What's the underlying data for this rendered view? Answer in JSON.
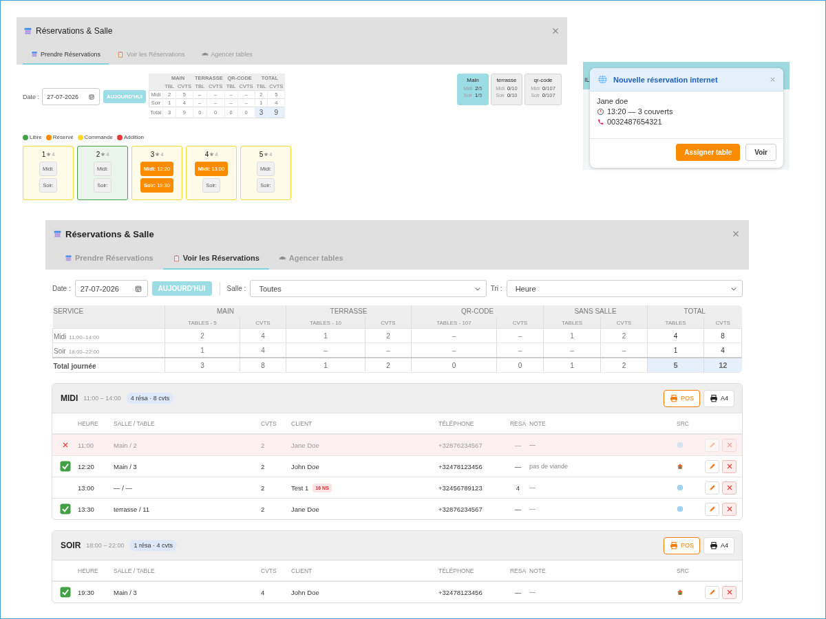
{
  "booking_panel": {
    "title": "Réservations & Salle",
    "tabs": [
      {
        "label": "Prendre Réservations",
        "selected": true
      },
      {
        "label": "Voir les Réservations",
        "selected": false
      },
      {
        "label": "Agencer tables",
        "selected": false
      }
    ],
    "date": {
      "label": "Date :",
      "value": "27-07-2026"
    },
    "today_button": "AUJOURD'HUI",
    "summary": {
      "groups": [
        {
          "label": "MAIN",
          "subs": [
            "TBL",
            "CVTS"
          ]
        },
        {
          "label": "TERRASSE",
          "subs": [
            "TBL",
            "CVTS"
          ]
        },
        {
          "label": "QR-CODE",
          "subs": [
            "TBL",
            "CVTS"
          ]
        },
        {
          "label": "TOTAL",
          "subs": [
            "TBL",
            "CVTS"
          ]
        }
      ],
      "rows": [
        {
          "label": "Midi",
          "kind": "service",
          "cells": [
            "2",
            "5",
            "–",
            "–",
            "–",
            "–",
            "2",
            "5"
          ]
        },
        {
          "label": "Soir",
          "kind": "service",
          "cells": [
            "1",
            "4",
            "–",
            "–",
            "–",
            "–",
            "1",
            "4"
          ]
        },
        {
          "label": "Total",
          "kind": "total",
          "cells": [
            "3",
            "9",
            "0",
            "0",
            "0",
            "0",
            "3",
            "9"
          ]
        }
      ]
    },
    "rooms": [
      {
        "name": "Main",
        "selected": true,
        "lines": [
          {
            "label": "Midi",
            "value": "**2**/5"
          },
          {
            "label": "Soir",
            "value": "**1**/5"
          }
        ]
      },
      {
        "name": "terrasse",
        "selected": false,
        "lines": [
          {
            "label": "Midi",
            "value": "**0**/10"
          },
          {
            "label": "Soir",
            "value": "**0**/10"
          }
        ]
      },
      {
        "name": "qr-code",
        "selected": false,
        "lines": [
          {
            "label": "Midi",
            "value": "**0**/107"
          },
          {
            "label": "Soir",
            "value": "**0**/107"
          }
        ]
      }
    ],
    "legend": [
      {
        "label": "Libre",
        "color": "#43a047"
      },
      {
        "label": "Réservé",
        "color": "#fb8c00"
      },
      {
        "label": "Commande",
        "color": "#fdd835"
      },
      {
        "label": "Addition",
        "color": "#e53935"
      }
    ],
    "tables": [
      {
        "number": "1",
        "seats": "4",
        "color": "#fdd835",
        "slots": [
          {
            "label": "Midi:",
            "booked": false
          },
          {
            "label": "Soir:",
            "booked": false
          }
        ]
      },
      {
        "number": "2",
        "seats": "4",
        "color": "#43a047",
        "slots": [
          {
            "label": "Midi:",
            "booked": false
          },
          {
            "label": "Soir:",
            "booked": false
          }
        ]
      },
      {
        "number": "3",
        "seats": "4",
        "color": "#fdd835",
        "slots": [
          {
            "label": "Midi:",
            "time": "12:20",
            "booked": true
          },
          {
            "label": "Soir:",
            "time": "19:30",
            "booked": true
          }
        ]
      },
      {
        "number": "4",
        "seats": "4",
        "color": "#fdd835",
        "slots": [
          {
            "label": "Midi:",
            "time": "13:00",
            "booked": true
          },
          {
            "label": "Soir:",
            "booked": false
          }
        ]
      },
      {
        "number": "5",
        "seats": "4",
        "color": "#fdd835",
        "slots": [
          {
            "label": "Midi:",
            "booked": false
          },
          {
            "label": "Soir:",
            "booked": false
          }
        ]
      }
    ]
  },
  "notification": {
    "backdrop_text": "IL",
    "title": "Nouvelle réservation internet",
    "name": "Jane doe",
    "time": "13:20 — 3 couverts",
    "phone": "0032487654321",
    "buttons": [
      {
        "label": "Assigner table",
        "kind": "primary"
      },
      {
        "label": "Voir",
        "kind": "secondary"
      }
    ]
  },
  "list_panel": {
    "title": "Réservations & Salle",
    "tabs": [
      {
        "label": "Prendre Réservations",
        "selected": false
      },
      {
        "label": "Voir les Réservations",
        "selected": true
      },
      {
        "label": "Agencer tables",
        "selected": false
      }
    ],
    "filters": {
      "date_label": "Date :",
      "date_value": "27-07-2026",
      "today_button": "AUJOURD'HUI",
      "room_label": "Salle :",
      "room_value": "Toutes",
      "sort_label": "Tri :",
      "sort_value": "Heure"
    },
    "summary": {
      "first_column": "SERVICE",
      "groups": [
        {
          "label": "MAIN",
          "subs": [
            "TABLES - 5",
            "CVTS"
          ]
        },
        {
          "label": "TERRASSE",
          "subs": [
            "TABLES - 10",
            "CVTS"
          ]
        },
        {
          "label": "QR-CODE",
          "subs": [
            "TABLES - 107",
            "CVTS"
          ]
        },
        {
          "label": "SANS SALLE",
          "subs": [
            "TABLES",
            "CVTS"
          ]
        },
        {
          "label": "TOTAL",
          "subs": [
            "TABLES",
            "CVTS"
          ]
        }
      ],
      "rows": [
        {
          "label": "Midi",
          "hours": "11:00–14:00",
          "kind": "service",
          "cells": [
            "2",
            "4",
            "1",
            "2",
            "–",
            "–",
            "1",
            "2",
            "4",
            "8"
          ]
        },
        {
          "label": "Soir",
          "hours": "18:00–22:00",
          "kind": "service",
          "cells": [
            "1",
            "4",
            "–",
            "–",
            "–",
            "–",
            "–",
            "–",
            "1",
            "4"
          ]
        },
        {
          "label": "Total journée",
          "kind": "total",
          "cells": [
            "3",
            "8",
            "1",
            "2",
            "0",
            "0",
            "1",
            "2",
            "5",
            "12"
          ]
        }
      ]
    },
    "services": [
      {
        "name": "MIDI",
        "hours": "11:00 – 14:00",
        "badge": "4 résa · 8 cvts",
        "buttons": [
          {
            "label": "POS",
            "kind": "pos"
          },
          {
            "label": "A4",
            "kind": "a4"
          }
        ],
        "columns": [
          "HEURE",
          "SALLE / TABLE",
          "CVTS",
          "CLIENT",
          "TÉLÉPHONE",
          "RESA",
          "NOTE",
          "SRC"
        ],
        "rows": [
          {
            "cancelled": true,
            "confirmed": false,
            "time": "11:00",
            "table": "Main / 2",
            "covers": "2",
            "client": "Jane Doe",
            "phone": "+32876234567",
            "resa": "—",
            "note": "—",
            "online": true
          },
          {
            "cancelled": false,
            "confirmed": true,
            "time": "12:20",
            "table": "Main / 3",
            "covers": "2",
            "client": "John Doe",
            "phone": "+32478123456",
            "resa": "—",
            "note": "pas de viande",
            "online": false
          },
          {
            "cancelled": false,
            "confirmed": false,
            "time": "13:00",
            "table": "— / —",
            "covers": "2",
            "client": "Test 1",
            "tag": "16 NS",
            "phone": "+32456789123",
            "resa": "4",
            "note": "—",
            "online": true
          },
          {
            "cancelled": false,
            "confirmed": true,
            "time": "13:30",
            "table": "terrasse / 11",
            "covers": "2",
            "client": "Jane Doe",
            "phone": "+32876234567",
            "resa": "—",
            "note": "—",
            "online": true
          }
        ]
      },
      {
        "name": "SOIR",
        "hours": "18:00 – 22:00",
        "badge": "1 résa · 4 cvts",
        "buttons": [
          {
            "label": "POS",
            "kind": "pos"
          },
          {
            "label": "A4",
            "kind": "a4"
          }
        ],
        "columns": [
          "HEURE",
          "SALLE / TABLE",
          "CVTS",
          "CLIENT",
          "TÉLÉPHONE",
          "RESA",
          "NOTE",
          "SRC"
        ],
        "rows": [
          {
            "cancelled": false,
            "confirmed": true,
            "time": "19:30",
            "table": "Main / 3",
            "covers": "4",
            "client": "John Doe",
            "phone": "+32478123456",
            "resa": "—",
            "note": "—",
            "online": false
          }
        ]
      }
    ]
  }
}
